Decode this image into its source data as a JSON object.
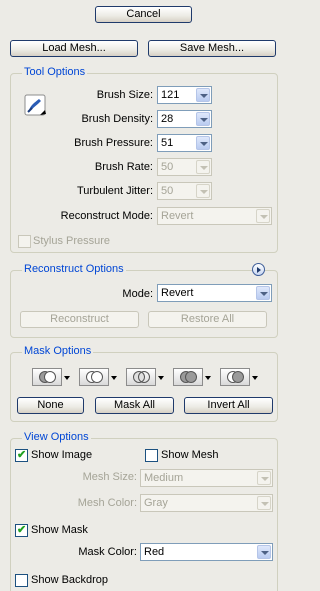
{
  "top": {
    "cancel_label": "Cancel",
    "load_mesh_label": "Load Mesh...",
    "save_mesh_label": "Save Mesh..."
  },
  "tool_options": {
    "title": "Tool Options",
    "brush_size": {
      "label": "Brush Size:",
      "value": "121"
    },
    "brush_density": {
      "label": "Brush Density:",
      "value": "28"
    },
    "brush_pressure": {
      "label": "Brush Pressure:",
      "value": "51"
    },
    "brush_rate": {
      "label": "Brush Rate:",
      "value": "50"
    },
    "turbulent_jitter": {
      "label": "Turbulent Jitter:",
      "value": "50"
    },
    "reconstruct_mode": {
      "label": "Reconstruct Mode:",
      "value": "Revert"
    },
    "stylus_pressure_label": "Stylus Pressure"
  },
  "reconstruct_options": {
    "title": "Reconstruct Options",
    "mode": {
      "label": "Mode:",
      "value": "Revert"
    },
    "reconstruct_label": "Reconstruct",
    "restore_all_label": "Restore All"
  },
  "mask_options": {
    "title": "Mask Options",
    "none_label": "None",
    "mask_all_label": "Mask All",
    "invert_all_label": "Invert All"
  },
  "view_options": {
    "title": "View Options",
    "show_image_label": "Show Image",
    "show_image_checked": true,
    "show_mesh_label": "Show Mesh",
    "show_mesh_checked": false,
    "mesh_size": {
      "label": "Mesh Size:",
      "value": "Medium"
    },
    "mesh_color": {
      "label": "Mesh Color:",
      "value": "Gray"
    },
    "show_mask_label": "Show Mask",
    "show_mask_checked": true,
    "mask_color": {
      "label": "Mask Color:",
      "value": "Red"
    },
    "show_backdrop_label": "Show Backdrop",
    "show_backdrop_checked": false
  },
  "colors": {
    "group_title": "#0046d5",
    "check_mark": "#21a121",
    "button_border": "#1f3a6b"
  },
  "icons": {
    "brush_tool": "liquify-brush-icon",
    "checkmark": "✔"
  }
}
